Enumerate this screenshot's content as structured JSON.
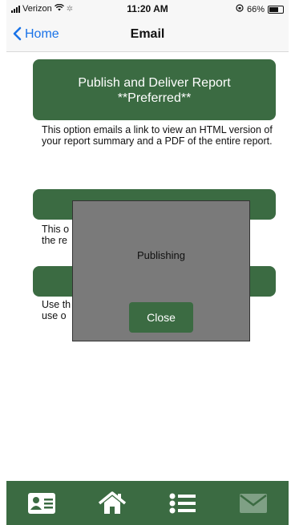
{
  "status_bar": {
    "carrier": "Verizon",
    "time": "11:20 AM",
    "battery": "66%"
  },
  "nav": {
    "back_label": "Home",
    "title": "Email"
  },
  "options": [
    {
      "label_line1": "Publish and Deliver Report",
      "label_line2": "**Preferred**",
      "description": "This option emails a link to view an HTML version of your report summary and a PDF of the entire report."
    },
    {
      "description": "This o... the re..."
    },
    {
      "description": "Use th... ...ge or use o..."
    }
  ],
  "dialog": {
    "message": "Publishing",
    "close_label": "Close"
  },
  "tabbar": {
    "items": [
      "contact-card-icon",
      "home-icon",
      "list-icon",
      "mail-icon"
    ]
  },
  "colors": {
    "accent_green": "#3b6b42",
    "link_blue": "#1a73e8",
    "dialog_gray": "#7a7a7a"
  }
}
